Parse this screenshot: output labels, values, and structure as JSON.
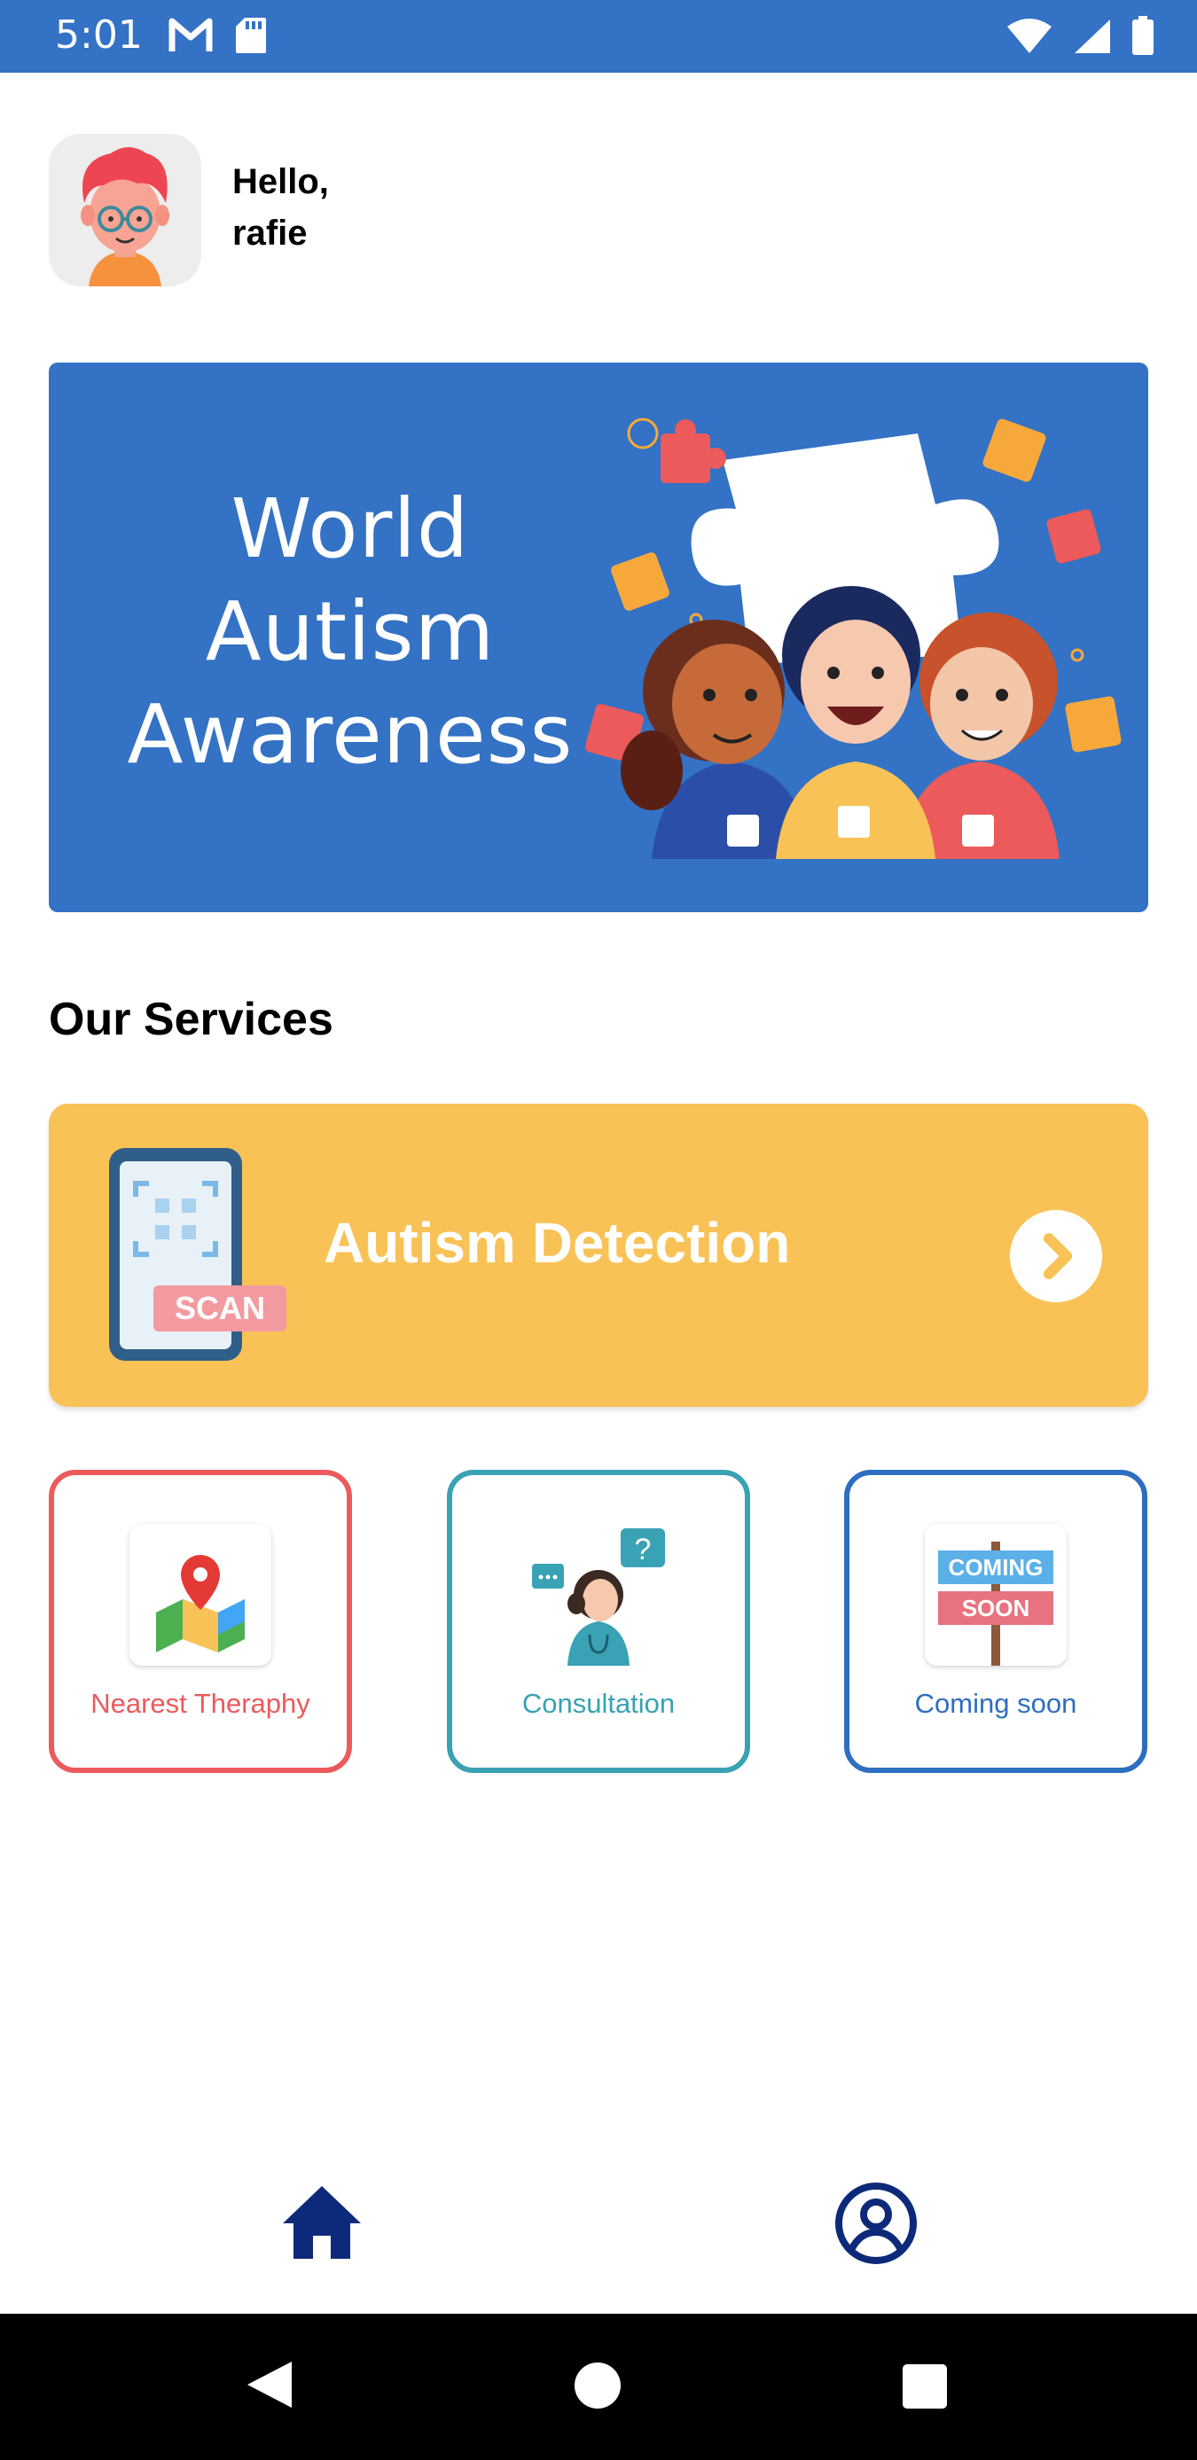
{
  "status_bar": {
    "time": "5:01",
    "left_icons": [
      "gmail-icon",
      "sd-card-icon"
    ],
    "right_icons": [
      "wifi-icon",
      "signal-icon",
      "battery-icon"
    ],
    "color": "#3372c4"
  },
  "header": {
    "greeting": "Hello,",
    "username": "rafie"
  },
  "banner": {
    "line1": "World",
    "line2": "Autism",
    "line3": "Awareness",
    "color": "#3372c4"
  },
  "services": {
    "title": "Our Services",
    "detection": {
      "label": "Autism Detection",
      "scan_text": "SCAN",
      "color": "#f9c256"
    },
    "tiles": [
      {
        "label": "Nearest Theraphy",
        "icon": "map-pin-icon",
        "color": "#ec5a5b"
      },
      {
        "label": "Consultation",
        "icon": "doctor-icon",
        "color": "#39a2b4"
      },
      {
        "label": "Coming soon",
        "icon": "coming-soon-sign-icon",
        "color": "#2e6ec0",
        "sign_line1": "COMING",
        "sign_line2": "SOON"
      }
    ]
  },
  "bottom_nav": {
    "items": [
      "home-icon",
      "profile-icon"
    ],
    "color": "#0d2a7a"
  },
  "system_nav": {
    "items": [
      "back-icon",
      "home-circle-icon",
      "recents-icon"
    ]
  }
}
